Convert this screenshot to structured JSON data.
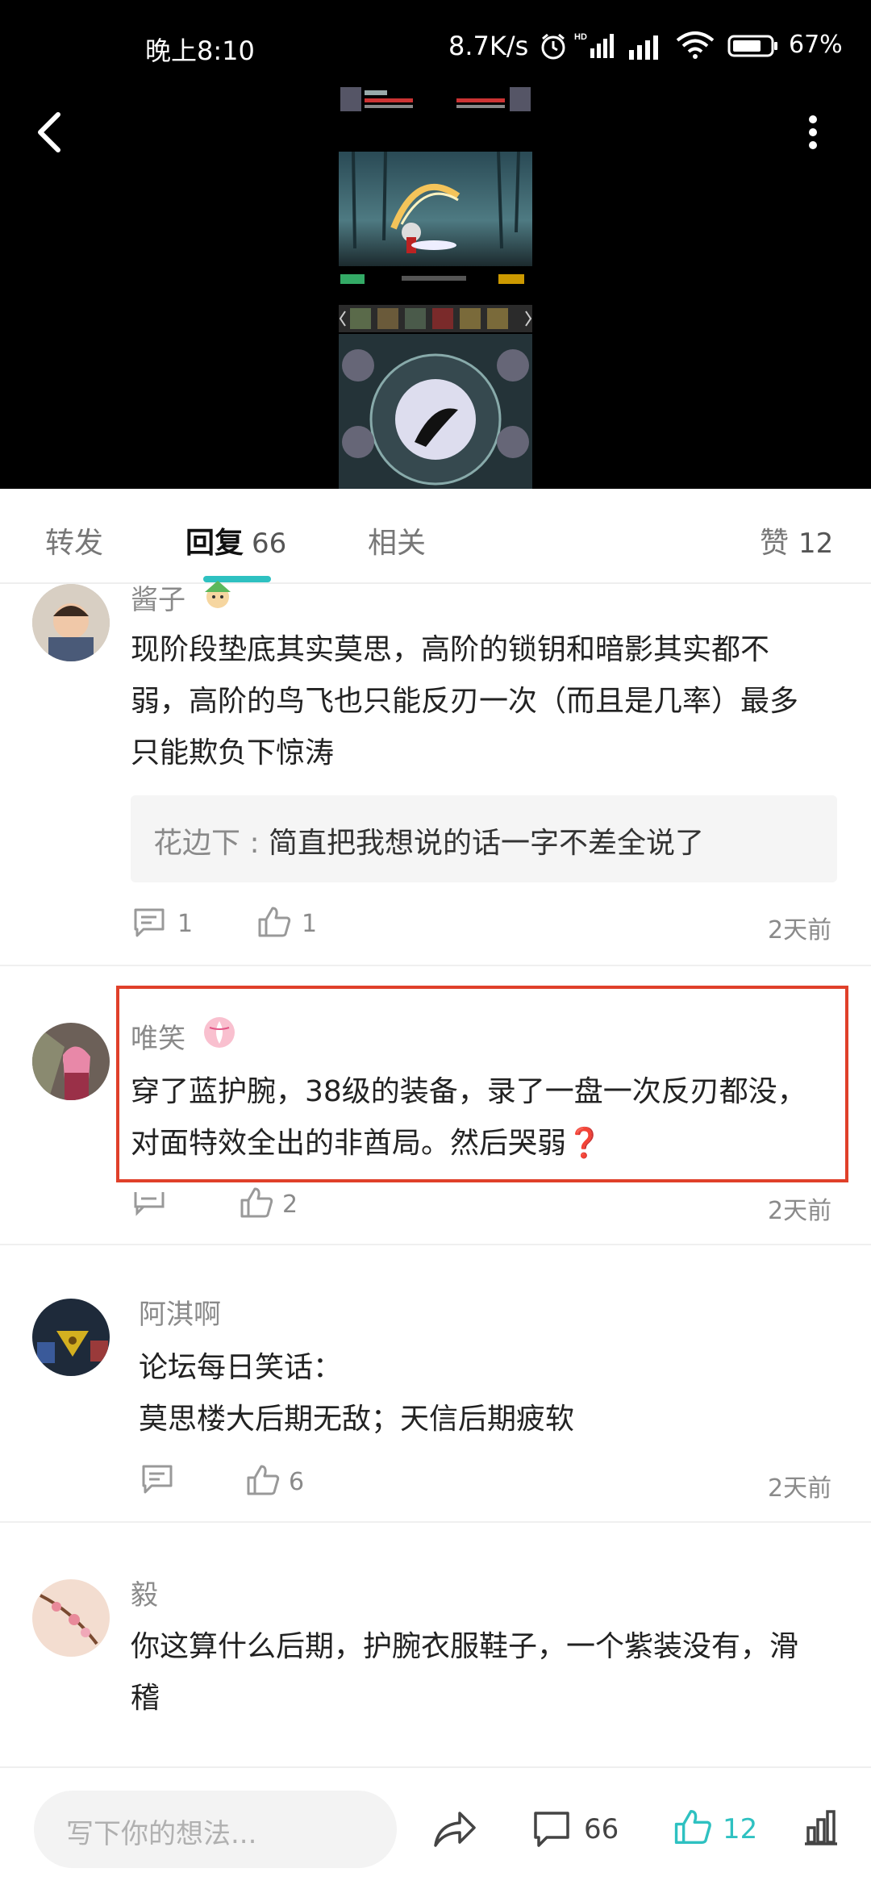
{
  "status_bar": {
    "time": "晚上8:10",
    "speed": "8.7K/s",
    "battery": "67%"
  },
  "tabs": {
    "forward": "转发",
    "reply": "回复",
    "reply_count": "66",
    "related": "相关",
    "like": "赞",
    "like_count": "12"
  },
  "comments": [
    {
      "user": "酱子",
      "line1": "现阶段垫底其实莫思，高阶的锁钥和暗影其实都不",
      "line2": "弱，高阶的鸟飞也只能反刃一次（而且是几率）最多",
      "line3": "只能欺负下惊涛",
      "reply_user": "花边下",
      "reply_sep": " : ",
      "reply_text": "简直把我想说的话一字不差全说了",
      "comments": "1",
      "likes": "1",
      "time": "2天前"
    },
    {
      "user": "唯笑",
      "line1": "穿了蓝护腕，38级的装备，录了一盘一次反刃都没，",
      "line2": "对面特效全出的非酋局。然后哭弱❓",
      "comments": "",
      "likes": "2",
      "time": "2天前"
    },
    {
      "user": "阿淇啊",
      "line1": "论坛每日笑话：",
      "line2": "莫思楼大后期无敌；天信后期疲软",
      "comments": "",
      "likes": "6",
      "time": "2天前"
    },
    {
      "user": "毅",
      "line1": "你这算什么后期，护腕衣服鞋子，一个紫装没有，滑",
      "line2": "稽"
    }
  ],
  "bottom_bar": {
    "placeholder": "写下你的想法...",
    "comment_count": "66",
    "like_count": "12"
  },
  "colors": {
    "accent": "#2ec1c1",
    "highlight_border": "#e0402a"
  }
}
